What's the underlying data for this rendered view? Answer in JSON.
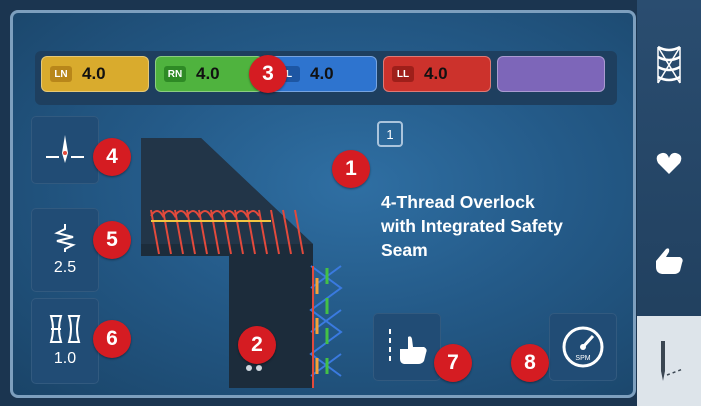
{
  "threads": [
    {
      "code": "LN",
      "value": "4.0",
      "color": "#d4a52a"
    },
    {
      "code": "RN",
      "value": "4.0",
      "color": "#4caf3c"
    },
    {
      "code": "L",
      "value": "4.0",
      "color": "#2b6fc9"
    },
    {
      "code": "LL",
      "value": "4.0",
      "color": "#c9302b"
    },
    {
      "code": "",
      "value": "",
      "color": "#7b63b7"
    }
  ],
  "stitch": {
    "number": "1",
    "description": "4-Thread Overlock\nwith Integrated Safety\nSeam"
  },
  "left_tools": {
    "needle_position_icon": "needle-position-icon",
    "stitch_length": "2.5",
    "differential_feed": "1.0"
  },
  "bottom_tools": {
    "hand_guide_icon": "hand-guide-icon",
    "speed_icon": "spm-speedometer-icon",
    "speed_label": "SPM"
  },
  "sidebar": {
    "items": [
      {
        "icon": "stitch-pattern-icon"
      },
      {
        "icon": "heart-icon"
      },
      {
        "icon": "hand-icon"
      },
      {
        "icon": "needle-icon",
        "active": true
      }
    ]
  },
  "callouts": [
    "1",
    "2",
    "3",
    "4",
    "5",
    "6",
    "7",
    "8"
  ],
  "colors": {
    "screen_bg": "#245a88",
    "badge_red": "#d51c22",
    "button_bg": "#214c75"
  }
}
